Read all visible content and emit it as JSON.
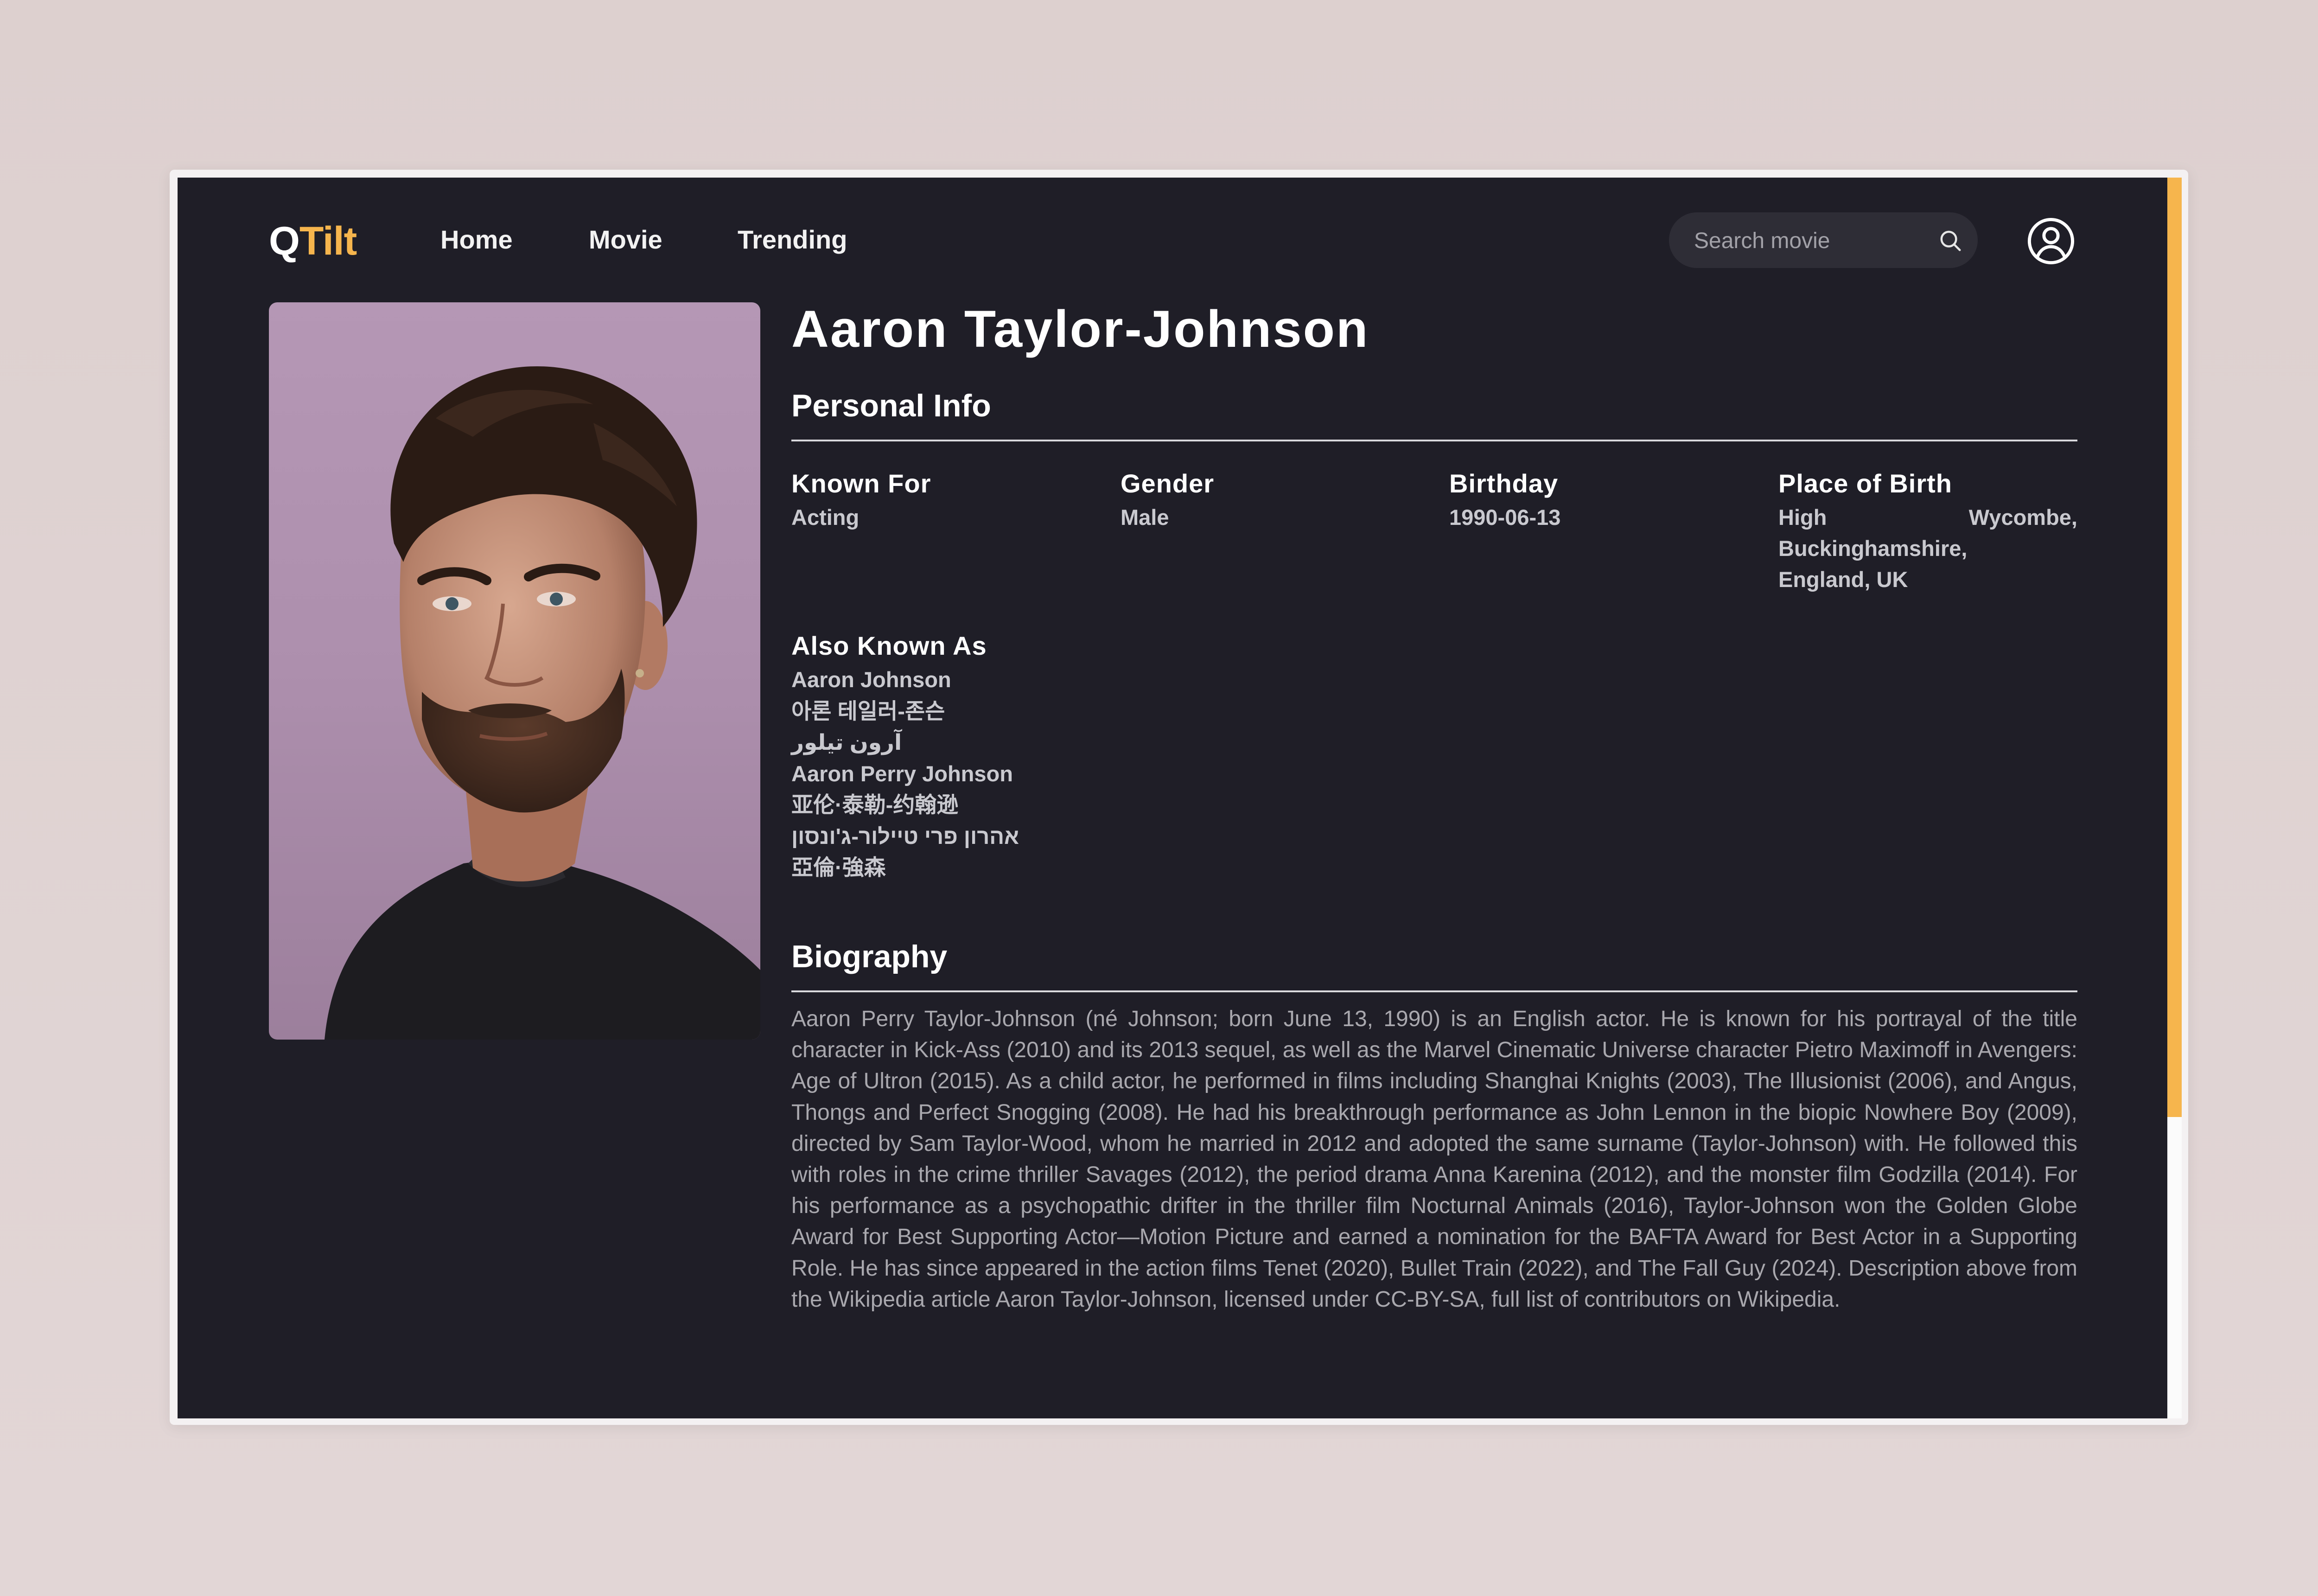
{
  "header": {
    "logo_first": "Q",
    "logo_rest": "Tilt",
    "nav": [
      {
        "label": "Home"
      },
      {
        "label": "Movie"
      },
      {
        "label": "Trending"
      }
    ],
    "search": {
      "placeholder": "Search movie",
      "icon": "search-icon"
    },
    "profile_icon": "user-circle-icon"
  },
  "person": {
    "name": "Aaron Taylor-Johnson",
    "portrait_alt": "Aaron Taylor-Johnson"
  },
  "personal_info": {
    "title": "Personal Info",
    "known_for": {
      "label": "Known For",
      "value": "Acting"
    },
    "gender": {
      "label": "Gender",
      "value": "Male"
    },
    "birthday": {
      "label": "Birthday",
      "value": "1990-06-13"
    },
    "place_of_birth": {
      "label": "Place of Birth",
      "value_word1": "High",
      "value_word2": "Wycombe,",
      "value_line2": "Buckinghamshire,",
      "value_line3": "England, UK"
    }
  },
  "also_known_as": {
    "title": "Also Known As",
    "names": [
      "Aaron Johnson",
      "아론 테일러-존슨",
      "آرون تیلور",
      "Aaron Perry Johnson",
      "亚伦·泰勒-约翰逊",
      "אהרון פרי טיילור-ג'ונסון",
      "亞倫·強森"
    ]
  },
  "biography": {
    "title": "Biography",
    "text": "Aaron Perry Taylor-Johnson (né Johnson; born June 13, 1990) is an English actor. He is known for his portrayal of the title character in Kick-Ass (2010) and its 2013 sequel, as well as the Marvel Cinematic Universe character Pietro Maximoff in Avengers: Age of Ultron (2015). As a child actor, he performed in films including Shanghai Knights (2003), The Illusionist (2006), and Angus, Thongs and Perfect Snogging (2008). He had his breakthrough performance as John Lennon in the biopic Nowhere Boy (2009), directed by Sam Taylor-Wood, whom he married in 2012 and adopted the same surname (Taylor-Johnson) with. He followed this with roles in the crime thriller Savages (2012), the period drama Anna Karenina (2012), and the monster film Godzilla (2014). For his performance as a psychopathic drifter in the thriller film Nocturnal Animals (2016), Taylor-Johnson won the Golden Globe Award for Best Supporting Actor—Motion Picture and earned a nomination for the BAFTA Award for Best Actor in a Supporting Role. He has since appeared in the action films Tenet (2020), Bullet Train (2022), and The Fall Guy (2024). Description above from the Wikipedia article Aaron Taylor-Johnson, licensed under CC-BY-SA, full list of contributors on Wikipedia."
  },
  "colors": {
    "accent": "#f6b54d",
    "app_background": "#1f1e27",
    "page_background": "#ddd0d0",
    "search_background": "#2e2d36"
  }
}
